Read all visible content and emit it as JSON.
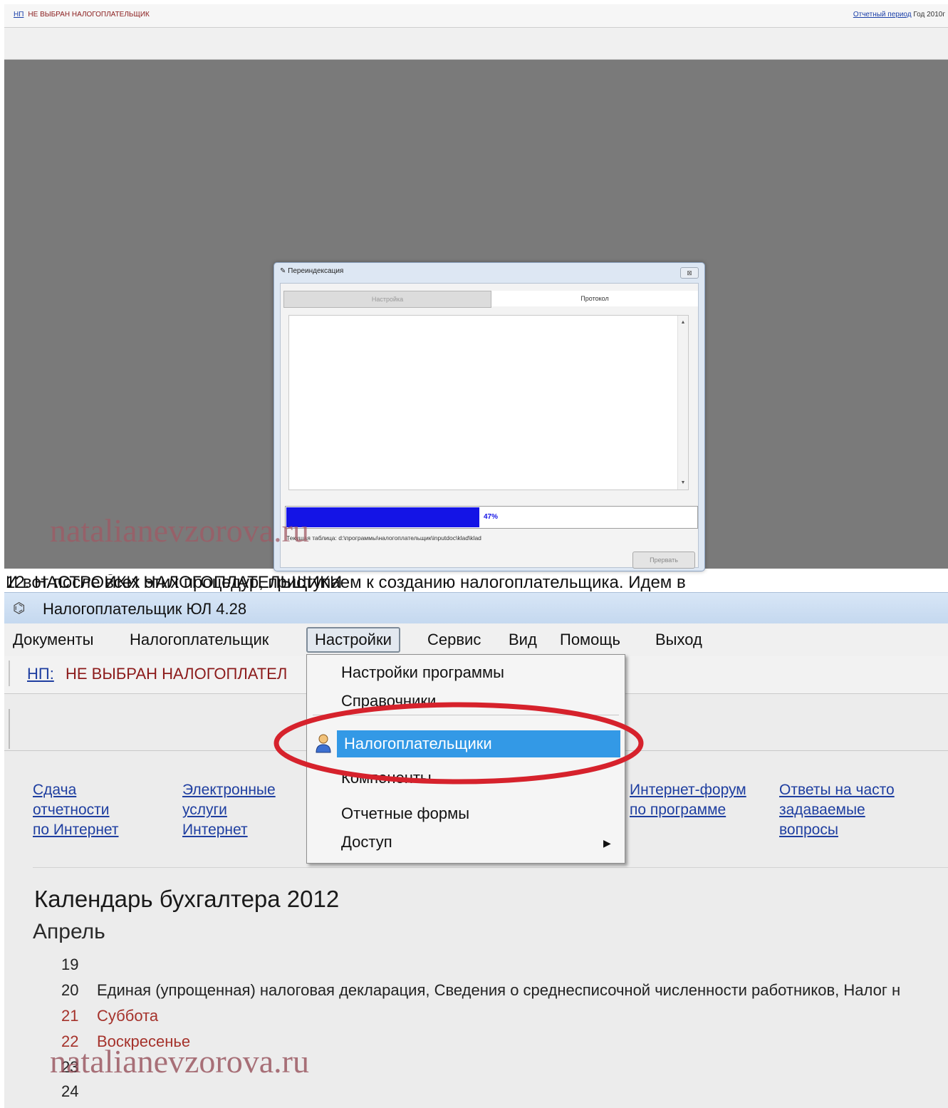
{
  "top": {
    "np_label": "НП",
    "np_value": "НЕ ВЫБРАН НАЛОГОПЛАТЕЛЬЩИК",
    "period_link": "Отчетный период",
    "period_value": "Год 2010г",
    "dialog": {
      "title": "Переиндексация",
      "close": "⊠",
      "tabs": [
        "Настройка",
        "Протокол"
      ],
      "progress_percent": 47,
      "progress_label": "47%",
      "current_table": "Текущая таблица: d:\\программы\\налогоплательщик\\inputdoc\\klad\\klad",
      "stop_button": "Прервать"
    },
    "watermark": "natalianevzorova.ru"
  },
  "caption": {
    "line_a": "12. НАСТРОЙКИ НАЛОГОПЛАТЕЛЬЩИКИ",
    "line_b": "И вот после всех этих процедур, приступаем к созданию налогоплательщика. Идем в"
  },
  "app": {
    "title": "Налогоплательщик ЮЛ 4.28",
    "menu": [
      "Документы",
      "Налогоплательщик",
      "Настройки",
      "Сервис",
      "Вид",
      "Помощь",
      "Выход"
    ],
    "np_label": "НП:",
    "np_value": "НЕ ВЫБРАН НАЛОГОПЛАТЕЛ",
    "dropdown": {
      "item_settings": "Настройки программы",
      "item_refs": "Справочники",
      "item_taxpayers": "Налогоплательщики",
      "item_components": "Компоненты",
      "item_forms": "Отчетные формы",
      "item_access": "Доступ"
    },
    "links": {
      "l1": [
        "Сдача",
        "отчетности",
        "по Интернет"
      ],
      "l2": [
        "Электронные",
        "услуги",
        "Интернет"
      ],
      "l3": [
        "Интернет-форум",
        "по программе"
      ],
      "l4": [
        "Ответы на часто",
        "задаваемые",
        "вопросы"
      ]
    },
    "calendar": {
      "title": "Календарь бухгалтера 2012",
      "month": "Апрель",
      "days": [
        {
          "n": "19",
          "t": ""
        },
        {
          "n": "20",
          "t": "Единая (упрощенная) налоговая декларация,  Сведения о среднесписочной численности работников,  Налог н"
        },
        {
          "n": "21",
          "t": "Суббота"
        },
        {
          "n": "22",
          "t": "Воскресенье"
        },
        {
          "n": "23",
          "t": ""
        },
        {
          "n": "24",
          "t": ""
        }
      ]
    },
    "watermark": "natalianevzorova.ru"
  }
}
